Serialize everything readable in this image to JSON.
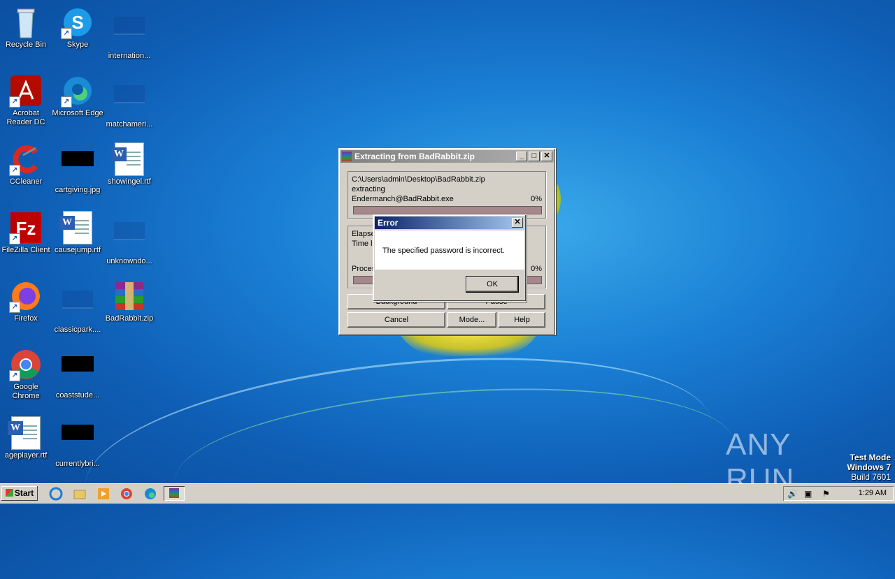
{
  "desktop": {
    "icons": [
      {
        "label": "Recycle Bin"
      },
      {
        "label": "Skype"
      },
      {
        "label": "internation..."
      },
      {
        "label": "Acrobat Reader DC"
      },
      {
        "label": "Microsoft Edge"
      },
      {
        "label": "matchameri..."
      },
      {
        "label": "CCleaner"
      },
      {
        "label": "cartgiving.jpg"
      },
      {
        "label": "showingel.rtf"
      },
      {
        "label": "FileZilla Client"
      },
      {
        "label": "causejump.rtf"
      },
      {
        "label": "unknowndo..."
      },
      {
        "label": "Firefox"
      },
      {
        "label": "classicpark...."
      },
      {
        "label": "BadRabbit.zip"
      },
      {
        "label": "Google Chrome"
      },
      {
        "label": "coaststude..."
      },
      {
        "label": "ageplayer.rtf"
      },
      {
        "label": "currentlybri..."
      }
    ]
  },
  "extract_window": {
    "title": "Extracting from BadRabbit.zip",
    "archive_path": "C:\\Users\\admin\\Desktop\\BadRabbit.zip",
    "action": "extracting",
    "file_name": "Endermanch@BadRabbit.exe",
    "file_percent": "0%",
    "file_progress": 0,
    "elapsed_label": "Elapse",
    "time_left_label": "Time le",
    "processed_label": "Proces",
    "processed_percent": "0%",
    "processed_progress": 0,
    "buttons": {
      "background": "Background",
      "pause": "Pause",
      "cancel": "Cancel",
      "mode": "Mode...",
      "help": "Help"
    }
  },
  "error_dialog": {
    "title": "Error",
    "message": "The specified password is incorrect.",
    "ok": "OK"
  },
  "taskbar": {
    "start": "Start",
    "clock": "1:29 AM"
  },
  "watermark": {
    "brand": "ANY RUN",
    "line1": "Test Mode",
    "line2": "Windows 7",
    "line3": "Build 7601"
  }
}
